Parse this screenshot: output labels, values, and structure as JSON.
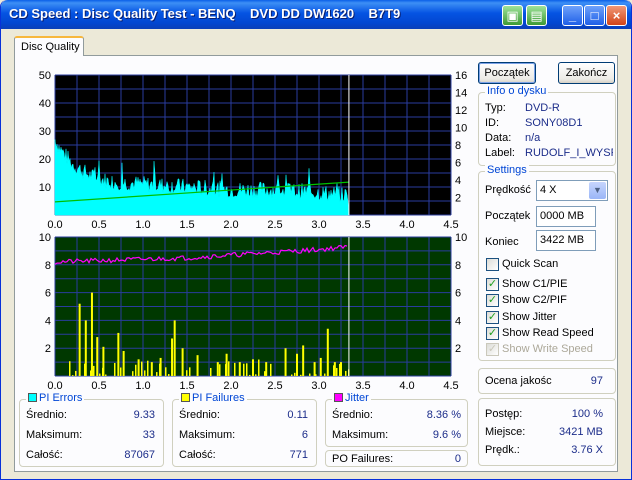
{
  "window": {
    "title": "CD Speed : Disc Quality Test - BENQ    DVD DD DW1620    B7T9"
  },
  "tab": {
    "label": "Disc Quality"
  },
  "buttons": {
    "start": "Początek",
    "end": "Zakończ"
  },
  "disc_info": {
    "legend": "Info o dysku",
    "rows": [
      {
        "label": "Typ:",
        "value": "DVD-R"
      },
      {
        "label": "ID:",
        "value": "SONY08D1"
      },
      {
        "label": "Data:",
        "value": "n/a"
      },
      {
        "label": "Label:",
        "value": "RUDOLF_I_WYSF"
      }
    ]
  },
  "settings": {
    "legend": "Settings",
    "speed_label": "Prędkość",
    "speed_value": "4 X",
    "start_label": "Początek",
    "start_value": "0000 MB",
    "end_label": "Koniec",
    "end_value": "3422 MB",
    "quick_scan": {
      "label": "Quick Scan",
      "checked": false
    },
    "checks": [
      {
        "label": "Show C1/PIE",
        "checked": true,
        "enabled": true
      },
      {
        "label": "Show C2/PIF",
        "checked": true,
        "enabled": true
      },
      {
        "label": "Show Jitter",
        "checked": true,
        "enabled": true
      },
      {
        "label": "Show Read Speed",
        "checked": true,
        "enabled": true
      },
      {
        "label": "Show Write Speed",
        "checked": true,
        "enabled": false
      }
    ]
  },
  "quality": {
    "label": "Ocena jakośc",
    "value": "97"
  },
  "progress": {
    "rows": [
      {
        "label": "Postęp:",
        "value": "100 %"
      },
      {
        "label": "Miejsce:",
        "value": "3421 MB"
      },
      {
        "label": "Prędk.:",
        "value": "3.76 X"
      }
    ]
  },
  "pi_errors": {
    "legend": "PI Errors",
    "color": "#00ffff",
    "rows": [
      {
        "label": "Średnio:",
        "value": "9.33"
      },
      {
        "label": "Maksimum:",
        "value": "33"
      },
      {
        "label": "Całość:",
        "value": "87067"
      }
    ]
  },
  "pi_failures": {
    "legend": "PI Failures",
    "color": "#ffff00",
    "rows": [
      {
        "label": "Średnio:",
        "value": "0.11"
      },
      {
        "label": "Maksimum:",
        "value": "6"
      },
      {
        "label": "Całość:",
        "value": "771"
      }
    ]
  },
  "jitter": {
    "legend": "Jitter",
    "color": "#ff00ff",
    "rows": [
      {
        "label": "Średnio:",
        "value": "8.36 %"
      },
      {
        "label": "Maksimum:",
        "value": "9.6 %"
      }
    ]
  },
  "po_failures": {
    "label": "PO Failures:",
    "value": "0"
  },
  "chart_data": [
    {
      "type": "area",
      "xlim": [
        0,
        4.5
      ],
      "ylim_left": [
        0,
        50
      ],
      "ylim_right": [
        0,
        16
      ],
      "x_ticks": [
        "0.0",
        "0.5",
        "1.0",
        "1.5",
        "2.0",
        "2.5",
        "3.0",
        "3.5",
        "4.0",
        "4.5"
      ],
      "y_ticks_left": [
        "10",
        "20",
        "30",
        "40",
        "50"
      ],
      "y_ticks_right": [
        "2",
        "4",
        "6",
        "8",
        "10",
        "12",
        "14",
        "16"
      ],
      "disc_end": 3.34,
      "pie_color": "#00ffff",
      "speed_color": "#00c000",
      "pie_profile": {
        "x": [
          0,
          0.05,
          0.2,
          0.4,
          0.6,
          1.0,
          1.5,
          2.0,
          2.5,
          3.0,
          3.34
        ],
        "y": [
          27,
          24,
          18,
          14,
          12,
          11,
          10,
          9,
          9,
          8,
          7
        ]
      },
      "read_speed": {
        "x": [
          0,
          3.34
        ],
        "y": [
          1.5,
          3.76
        ]
      }
    },
    {
      "type": "bar",
      "xlim": [
        0,
        4.5
      ],
      "ylim_left": [
        0,
        10
      ],
      "ylim_right": [
        0,
        10
      ],
      "x_ticks": [
        "0.0",
        "0.5",
        "1.0",
        "1.5",
        "2.0",
        "2.5",
        "3.0",
        "3.5",
        "4.0",
        "4.5"
      ],
      "y_ticks_left": [
        "2",
        "4",
        "6",
        "8",
        "10"
      ],
      "y_ticks_right": [
        "2",
        "4",
        "6",
        "8",
        "10"
      ],
      "disc_end": 3.34,
      "pif_color": "#ffff00",
      "jitter_color": "#ff00ff",
      "jitter_profile": {
        "x": [
          0,
          0.5,
          1.0,
          1.5,
          2.0,
          2.5,
          3.0,
          3.34
        ],
        "y": [
          8.2,
          8.3,
          8.4,
          8.5,
          8.7,
          8.9,
          9.1,
          9.3
        ]
      },
      "pif_bars": [
        {
          "x": 0.28,
          "y": 5.2
        },
        {
          "x": 0.35,
          "y": 4.0
        },
        {
          "x": 0.42,
          "y": 6.0
        },
        {
          "x": 0.48,
          "y": 2.8
        },
        {
          "x": 0.55,
          "y": 2.1
        },
        {
          "x": 0.72,
          "y": 3.1
        },
        {
          "x": 0.78,
          "y": 1.8
        },
        {
          "x": 0.95,
          "y": 1.2
        },
        {
          "x": 1.1,
          "y": 1.0
        },
        {
          "x": 1.2,
          "y": 1.3
        },
        {
          "x": 1.33,
          "y": 2.7
        },
        {
          "x": 1.36,
          "y": 4.0
        },
        {
          "x": 1.45,
          "y": 2.0
        },
        {
          "x": 1.62,
          "y": 1.5
        },
        {
          "x": 1.85,
          "y": 1.0
        },
        {
          "x": 1.95,
          "y": 1.6
        },
        {
          "x": 2.1,
          "y": 1.0
        },
        {
          "x": 2.25,
          "y": 1.2
        },
        {
          "x": 2.4,
          "y": 1.0
        },
        {
          "x": 2.62,
          "y": 2.0
        },
        {
          "x": 2.75,
          "y": 1.6
        },
        {
          "x": 2.82,
          "y": 2.2
        },
        {
          "x": 2.95,
          "y": 1.0
        },
        {
          "x": 3.02,
          "y": 1.3
        },
        {
          "x": 3.1,
          "y": 3.4
        },
        {
          "x": 3.18,
          "y": 1.0
        },
        {
          "x": 3.25,
          "y": 1.0
        }
      ]
    }
  ]
}
